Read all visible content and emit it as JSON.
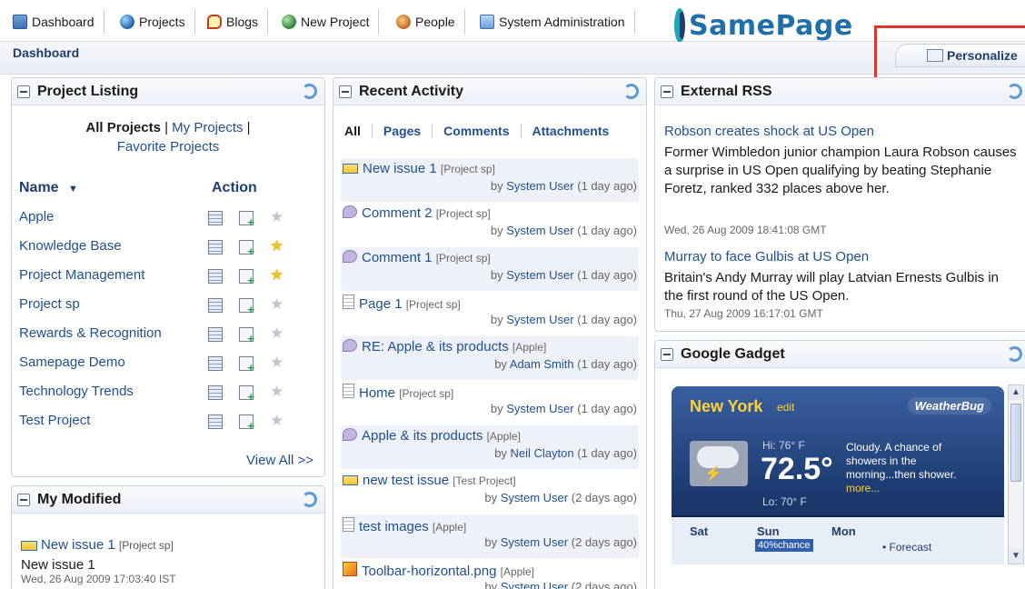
{
  "nav": {
    "tabs": [
      {
        "label": "Dashboard",
        "icon": "dashboard-icon"
      },
      {
        "label": "Projects",
        "icon": "globe-icon"
      },
      {
        "label": "Blogs",
        "icon": "blog-icon"
      },
      {
        "label": "New Project",
        "icon": "new-project-icon"
      },
      {
        "label": "People",
        "icon": "people-icon"
      },
      {
        "label": "System Administration",
        "icon": "admin-icon"
      }
    ],
    "logo": "SamePage"
  },
  "breadcrumb": "Dashboard",
  "personalize_label": "Personalize",
  "project_listing": {
    "title": "Project Listing",
    "filter_all": "All Projects",
    "filter_sep": " | ",
    "filter_mine": "My Projects",
    "filter_sep2": " | ",
    "filter_fav": "Favorite Projects",
    "col_name": "Name",
    "col_action": "Action",
    "rows": [
      {
        "name": "Apple",
        "favorite": false
      },
      {
        "name": "Knowledge Base",
        "favorite": true
      },
      {
        "name": "Project Management",
        "favorite": true
      },
      {
        "name": "Project sp",
        "favorite": false
      },
      {
        "name": "Rewards & Recognition",
        "favorite": false
      },
      {
        "name": "Samepage Demo",
        "favorite": false
      },
      {
        "name": "Technology Trends",
        "favorite": false
      },
      {
        "name": "Test Project",
        "favorite": false
      }
    ],
    "view_all": "View All >>"
  },
  "my_modified": {
    "title": "My Modified",
    "item_title": "New issue 1",
    "item_project": "[Project sp]",
    "item_name": "New issue 1",
    "item_date": "Wed, 26 Aug 2009 17:03:40 IST"
  },
  "recent_activity": {
    "title": "Recent Activity",
    "filters": [
      "All",
      "Pages",
      "Comments",
      "Attachments"
    ],
    "items": [
      {
        "title": "New issue 1",
        "project": "[Project sp]",
        "by_prefix": "by ",
        "user": "System User",
        "when": " (1 day ago)",
        "kind": "issue"
      },
      {
        "title": "Comment 2",
        "project": "[Project sp]",
        "by_prefix": "by ",
        "user": "System User",
        "when": " (1 day ago)",
        "kind": "comment"
      },
      {
        "title": "Comment 1",
        "project": "[Project sp]",
        "by_prefix": "by ",
        "user": "System User",
        "when": " (1 day ago)",
        "kind": "comment"
      },
      {
        "title": "Page 1",
        "project": "[Project sp]",
        "by_prefix": "by ",
        "user": "System User",
        "when": " (1 day ago)",
        "kind": "page"
      },
      {
        "title": "RE: Apple & its products",
        "project": "[Apple]",
        "by_prefix": "by ",
        "user": "Adam Smith",
        "when": " (1 day ago)",
        "kind": "comment"
      },
      {
        "title": "Home",
        "project": "[Project sp]",
        "by_prefix": "by ",
        "user": "System User",
        "when": " (1 day ago)",
        "kind": "page"
      },
      {
        "title": "Apple & its products",
        "project": "[Apple]",
        "by_prefix": "by ",
        "user": "Neil Clayton",
        "when": " (1 day ago)",
        "kind": "comment"
      },
      {
        "title": "new test issue",
        "project": "[Test Project]",
        "by_prefix": "by ",
        "user": "System User",
        "when": " (2 days ago)",
        "kind": "issue"
      },
      {
        "title": "test images",
        "project": "[Apple]",
        "by_prefix": "by ",
        "user": "System User",
        "when": " (2 days ago)",
        "kind": "page"
      },
      {
        "title": "Toolbar-horizontal.png",
        "project": "[Apple]",
        "by_prefix": "by ",
        "user": "System User",
        "when": " (2 days ago)",
        "kind": "image"
      }
    ]
  },
  "external_rss": {
    "title": "External RSS",
    "items": [
      {
        "title": "Robson creates shock at US Open",
        "desc": "Former Wimbledon junior champion Laura Robson causes a surprise in US Open qualifying by beating Stephanie Foretz, ranked 332 places above her.",
        "date": "Wed, 26 Aug 2009 18:41:08 GMT"
      },
      {
        "title": "Murray to face Gulbis at US Open",
        "desc": "Britain's Andy Murray will play Latvian Ernests Gulbis in the first round of the US Open.",
        "date": "Thu, 27 Aug 2009 16:17:01 GMT"
      }
    ]
  },
  "google_gadget": {
    "title": "Google Gadget",
    "city": "New York",
    "edit": "edit",
    "brand": "WeatherBug",
    "hi": "Hi: 76° F",
    "temp": "72.5°",
    "lo": "Lo: 70° F",
    "desc": "Cloudy. A chance of showers in the morning...then shower.",
    "more": "more...",
    "days": [
      "Sat",
      "Sun",
      "Mon"
    ],
    "chance": "40%chance",
    "forecast": "• Forecast"
  }
}
